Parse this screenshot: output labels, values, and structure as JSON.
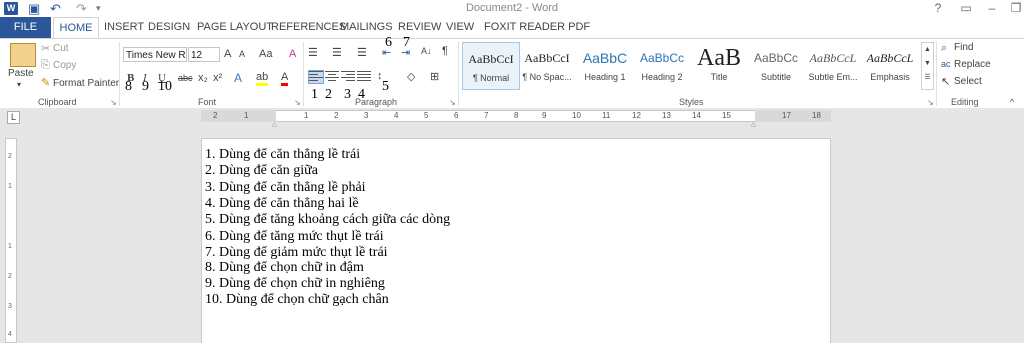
{
  "titlebar": {
    "title": "Document2 - Word",
    "app_icon": "W"
  },
  "tabs": [
    "FILE",
    "HOME",
    "INSERT",
    "DESIGN",
    "PAGE LAYOUT",
    "REFERENCES",
    "MAILINGS",
    "REVIEW",
    "VIEW",
    "FOXIT READER PDF"
  ],
  "clipboard": {
    "paste": "Paste",
    "cut": "Cut",
    "copy": "Copy",
    "format_painter": "Format Painter",
    "label": "Clipboard"
  },
  "font": {
    "name": "Times New R",
    "size": "12",
    "label": "Font",
    "bold": "B",
    "italic": "I",
    "underline": "U",
    "abc": "abc",
    "sub": "x₂",
    "sup": "x²",
    "grow": "A",
    "shrink": "A",
    "case": "Aa",
    "clear": "A",
    "effects": "A",
    "highlight": "ab",
    "color": "A"
  },
  "paragraph": {
    "label": "Paragraph",
    "sort": "A↓",
    "pilcrow": "¶"
  },
  "styles": {
    "label": "Styles",
    "items": [
      {
        "sample": "AaBbCcI",
        "name": "¶ Normal"
      },
      {
        "sample": "AaBbCcI",
        "name": "¶ No Spac..."
      },
      {
        "sample": "AaBbC",
        "name": "Heading 1"
      },
      {
        "sample": "AaBbCc",
        "name": "Heading 2"
      },
      {
        "sample": "AaB",
        "name": "Title"
      },
      {
        "sample": "AaBbCc",
        "name": "Subtitle"
      },
      {
        "sample": "AaBbCcL",
        "name": "Subtle Em..."
      },
      {
        "sample": "AaBbCcL",
        "name": "Emphasis"
      }
    ]
  },
  "editing": {
    "find": "Find",
    "replace": "Replace",
    "select": "Select",
    "label": "Editing"
  },
  "annotations": {
    "n1": "1",
    "n2": "2",
    "n3": "3",
    "n4": "4",
    "n5": "5",
    "n6": "6",
    "n7": "7",
    "n8": "8",
    "n9": "9",
    "n10": "10"
  },
  "ruler": {
    "tab_selector": "L",
    "numbers": [
      "2",
      "1",
      "1",
      "2",
      "3",
      "4",
      "5",
      "6",
      "7",
      "8",
      "9",
      "10",
      "11",
      "12",
      "13",
      "14",
      "15",
      "17",
      "18"
    ]
  },
  "vruler": [
    "2",
    "1",
    "1",
    "2",
    "3",
    "4"
  ],
  "document": {
    "lines": [
      "1. Dùng để căn thẳng lề trái",
      "2. Dùng để căn giữa",
      "3. Dùng để căn thẳng lề phải",
      "4. Dùng để căn thẳng hai lề",
      "5. Dùng để tăng khoảng cách giữa các dòng",
      "6. Dùng để tăng mức thụt lề trái",
      "7. Dùng để giảm mức thụt lề trái",
      "8. Dùng để chọn chữ in đậm",
      "9. Dùng để chọn chữ in nghiêng",
      "10. Dùng để chọn chữ gạch chân"
    ]
  },
  "colors": {
    "accent": "#2b579a",
    "highlight": "#ffff00",
    "font_color": "#ff0000"
  }
}
